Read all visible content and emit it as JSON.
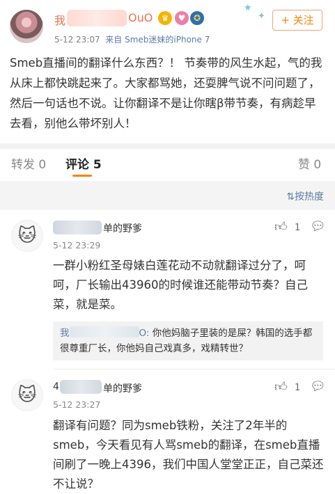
{
  "post": {
    "author_prefix": "我",
    "author_suffix": "OuO",
    "time": "5-12 23:07",
    "source": "来自 Smeb迷妹的iPhone 7",
    "follow_label": "+ 关注",
    "text": "Smeb直播间的翻译什么东西？！ 节奏带的风生水起，气的我从床上都快跳起来了。大家都骂她，还耍脾气说不问问题了，然后一句话也不说。让你翻译不是让你瞎β带节奏，有病趁早去看，别他么带坏别人！"
  },
  "tabs": {
    "repost": "转发 0",
    "comment": "评论 5",
    "like": "赞 0",
    "sort": "按热度"
  },
  "comments": [
    {
      "name_suffix": "单的野爹",
      "time": "5-12 23:29",
      "likes": "1",
      "text": "一群小粉红圣母婊白莲花动不动就翻译过分了，呵呵，厂长输出43960的时候谁还能带动节奏？自己菜，就是菜。",
      "reply": {
        "name_prefix": "我",
        "name_suffix": "O:",
        "text": "你他妈脑子里装的是屎？韩国的选手都很尊重厂长，你他妈自己戏真多，戏精转世？"
      }
    },
    {
      "name_prefix": "4",
      "name_suffix": "单的野爹",
      "time": "5-12 23:27",
      "likes": "1",
      "text": "翻译有问题？同为smeb铁粉，关注了2年半的smeb，今天看见有人骂smeb的翻译，在smeb直播间刷了一晚上4396，我们中国人堂堂正正，自己菜还不让说？"
    }
  ],
  "colors": {
    "accent": "#ff8200",
    "username": "#eb7350",
    "link": "#5b7ba4"
  }
}
